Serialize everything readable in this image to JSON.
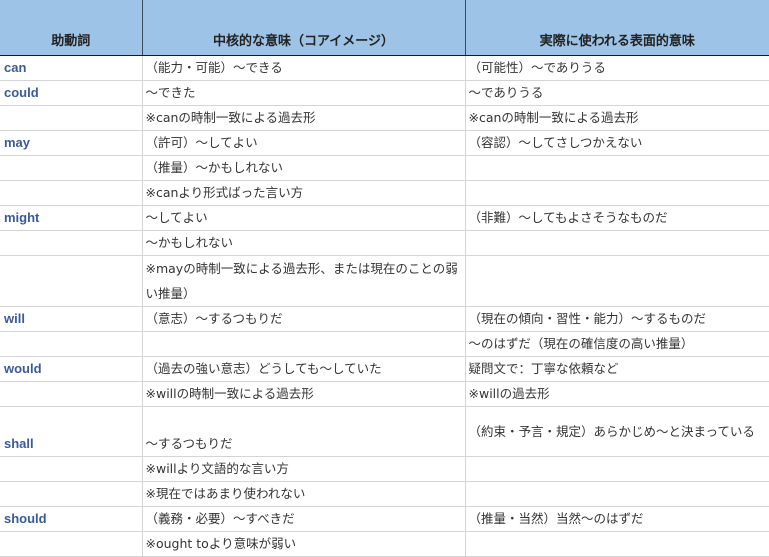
{
  "header": {
    "col1": "助動詞",
    "col2": "中核的な意味（コアイメージ）",
    "col3": "実際に使われる表面的意味"
  },
  "rows": [
    {
      "verb": "can",
      "core": "（能力・可能）～できる",
      "surface": "（可能性）～でありうる"
    },
    {
      "verb": "could",
      "core": "～できた",
      "surface": "～でありうる"
    },
    {
      "verb": "",
      "core": "※canの時制一致による過去形",
      "surface": "※canの時制一致による過去形"
    },
    {
      "verb": "may",
      "core": "（許可）～してよい",
      "surface": "（容認）～してさしつかえない"
    },
    {
      "verb": "",
      "core": "（推量）～かもしれない",
      "surface": ""
    },
    {
      "verb": "",
      "core": "※canより形式ばった言い方",
      "surface": ""
    },
    {
      "verb": "might",
      "core": "～してよい",
      "surface": "（非難）～してもよさそうなものだ"
    },
    {
      "verb": "",
      "core": "～かもしれない",
      "surface": ""
    },
    {
      "verb": "",
      "core": "※mayの時制一致による過去形、または現在のことの弱い推量）",
      "surface": ""
    },
    {
      "verb": "will",
      "core": "（意志）～するつもりだ",
      "surface": "（現在の傾向・習性・能力）～するものだ"
    },
    {
      "verb": "",
      "core": "",
      "surface": "～のはずだ（現在の確信度の高い推量）"
    },
    {
      "verb": "would",
      "core": "（過去の強い意志）どうしても～していた",
      "surface": "疑問文で：丁寧な依頼など"
    },
    {
      "verb": "",
      "core": "※willの時制一致による過去形",
      "surface": "※willの過去形"
    },
    {
      "verb": "shall",
      "core": "～するつもりだ",
      "surface": "（約束・予言・規定）あらかじめ～と決まっている"
    },
    {
      "verb": "",
      "core": "※willより文語的な言い方",
      "surface": ""
    },
    {
      "verb": "",
      "core": "※現在ではあまり使われない",
      "surface": ""
    },
    {
      "verb": "should",
      "core": "（義務・必要）～すべきだ",
      "surface": "（推量・当然）当然～のはずだ"
    },
    {
      "verb": "",
      "core": "※ought toより意味が弱い",
      "surface": ""
    }
  ]
}
